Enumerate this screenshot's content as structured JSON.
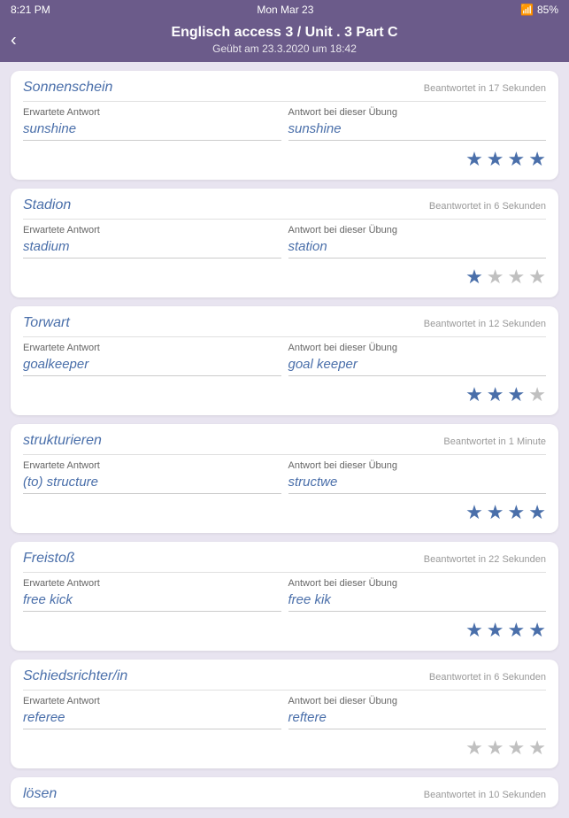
{
  "statusBar": {
    "time": "8:21 PM",
    "day": "Mon Mar 23",
    "battery": "85%"
  },
  "header": {
    "title": "Englisch access 3 / Unit . 3 Part C",
    "subtitle": "Geübt am  23.3.2020 um 18:42",
    "backLabel": "‹"
  },
  "cards": [
    {
      "word": "Sonnenschein",
      "time": "Beantwortet in 17 Sekunden",
      "expectedLabel": "Erwartete Antwort",
      "expectedValue": "sunshine",
      "givenLabel": "Antwort bei dieser Übung",
      "givenValue": "sunshine",
      "stars": 4,
      "maxStars": 4
    },
    {
      "word": "Stadion",
      "time": "Beantwortet in 6 Sekunden",
      "expectedLabel": "Erwartete Antwort",
      "expectedValue": "stadium",
      "givenLabel": "Antwort bei dieser Übung",
      "givenValue": "station",
      "stars": 1,
      "maxStars": 4
    },
    {
      "word": "Torwart",
      "time": "Beantwortet in 12 Sekunden",
      "expectedLabel": "Erwartete Antwort",
      "expectedValue": "goalkeeper",
      "givenLabel": "Antwort bei dieser Übung",
      "givenValue": "goal keeper",
      "stars": 3,
      "maxStars": 4
    },
    {
      "word": "strukturieren",
      "time": "Beantwortet in 1 Minute",
      "expectedLabel": "Erwartete Antwort",
      "expectedValue": "(to) structure",
      "givenLabel": "Antwort bei dieser Übung",
      "givenValue": "structwe",
      "stars": 4,
      "maxStars": 4
    },
    {
      "word": "Freistoß",
      "time": "Beantwortet in 22 Sekunden",
      "expectedLabel": "Erwartete Antwort",
      "expectedValue": "free kick",
      "givenLabel": "Antwort bei dieser Übung",
      "givenValue": "free kik",
      "stars": 4,
      "maxStars": 4
    },
    {
      "word": "Schiedsrichter/in",
      "time": "Beantwortet in 6 Sekunden",
      "expectedLabel": "Erwartete Antwort",
      "expectedValue": "referee",
      "givenLabel": "Antwort bei dieser Übung",
      "givenValue": "reftere",
      "stars": 0,
      "maxStars": 4
    }
  ],
  "partialCard": {
    "word": "lösen",
    "time": "Beantwortet in 10 Sekunden"
  }
}
